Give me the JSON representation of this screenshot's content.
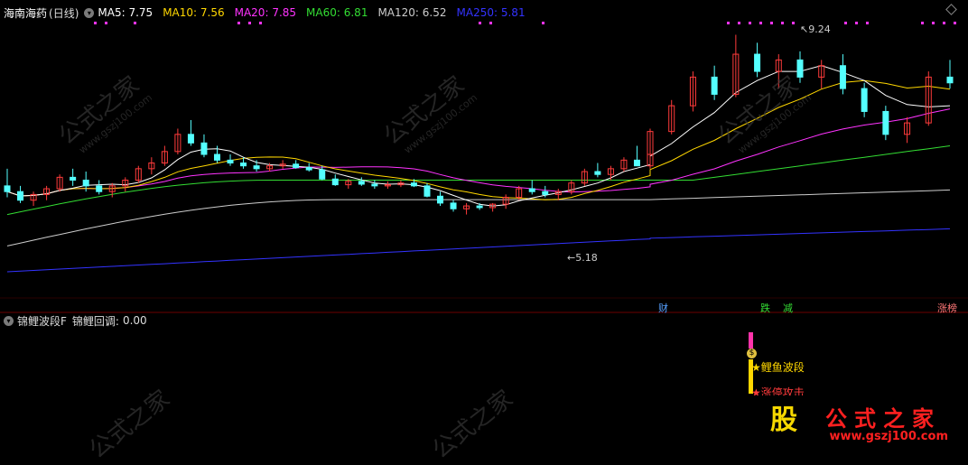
{
  "header": {
    "stock_name": "海南海药",
    "period": "(日线)",
    "ma": [
      {
        "label": "MA5:",
        "value": "7.75",
        "color": "#ffffff"
      },
      {
        "label": "MA10:",
        "value": "7.56",
        "color": "#ffd700"
      },
      {
        "label": "MA20:",
        "value": "7.85",
        "color": "#ff33ff"
      },
      {
        "label": "MA60:",
        "value": "6.81",
        "color": "#33dd33"
      },
      {
        "label": "MA120:",
        "value": "6.52",
        "color": "#cccccc"
      },
      {
        "label": "MA250:",
        "value": "5.81",
        "color": "#3333ff"
      }
    ]
  },
  "annotations": {
    "high_price": "9.24",
    "low_price": "5.18",
    "high_marker": "↖",
    "low_marker": "←",
    "event_cai": "财",
    "event_die": "跌",
    "event_jian": "减",
    "event_zhangban": "涨榜"
  },
  "indicator": {
    "name": "锦鲤波段F",
    "field_label": "锦鲤回调:",
    "field_value": "0.00",
    "signal_label": "★鲤鱼波段",
    "signal_label2": "★涨停攻击",
    "coin_glyph": "$"
  },
  "watermark": {
    "text": "公式之家",
    "url": "www.gszj100.com",
    "logo_glyph": "股"
  },
  "colors": {
    "up": "#ff3b3b",
    "down": "#54ffff",
    "ma5": "#ffffff",
    "ma10": "#ffd700",
    "ma20": "#ff33ff",
    "ma60": "#33dd33",
    "ma120": "#cccccc",
    "ma250": "#3333ff",
    "dots": "#ff33ff",
    "divider": "#6b0000"
  },
  "chart_data": {
    "type": "candlestick",
    "title": "",
    "ylim": [
      4.8,
      9.5
    ],
    "ohlc_approx": [
      [
        6.6,
        6.9,
        6.4,
        6.5
      ],
      [
        6.5,
        6.6,
        6.3,
        6.35
      ],
      [
        6.35,
        6.5,
        6.25,
        6.45
      ],
      [
        6.45,
        6.6,
        6.35,
        6.55
      ],
      [
        6.55,
        6.8,
        6.5,
        6.75
      ],
      [
        6.75,
        6.9,
        6.6,
        6.7
      ],
      [
        6.7,
        6.85,
        6.5,
        6.6
      ],
      [
        6.6,
        6.7,
        6.45,
        6.5
      ],
      [
        6.5,
        6.65,
        6.4,
        6.6
      ],
      [
        6.6,
        6.75,
        6.5,
        6.7
      ],
      [
        6.7,
        6.95,
        6.65,
        6.9
      ],
      [
        6.9,
        7.1,
        6.8,
        7.0
      ],
      [
        7.0,
        7.3,
        6.95,
        7.2
      ],
      [
        7.2,
        7.6,
        7.15,
        7.5
      ],
      [
        7.5,
        7.75,
        7.3,
        7.35
      ],
      [
        7.35,
        7.5,
        7.1,
        7.15
      ],
      [
        7.15,
        7.3,
        7.0,
        7.05
      ],
      [
        7.05,
        7.15,
        6.95,
        7.0
      ],
      [
        7.0,
        7.1,
        6.9,
        6.95
      ],
      [
        6.95,
        7.05,
        6.85,
        6.9
      ],
      [
        6.9,
        7.0,
        6.85,
        6.95
      ],
      [
        6.95,
        7.05,
        6.9,
        6.98
      ],
      [
        6.98,
        7.05,
        6.9,
        6.92
      ],
      [
        6.92,
        7.0,
        6.85,
        6.88
      ],
      [
        6.88,
        6.95,
        6.7,
        6.72
      ],
      [
        6.72,
        6.8,
        6.6,
        6.62
      ],
      [
        6.62,
        6.72,
        6.55,
        6.68
      ],
      [
        6.68,
        6.75,
        6.6,
        6.63
      ],
      [
        6.63,
        6.7,
        6.55,
        6.6
      ],
      [
        6.6,
        6.68,
        6.55,
        6.62
      ],
      [
        6.62,
        6.7,
        6.58,
        6.65
      ],
      [
        6.65,
        6.72,
        6.58,
        6.6
      ],
      [
        6.6,
        6.65,
        6.4,
        6.42
      ],
      [
        6.42,
        6.5,
        6.25,
        6.3
      ],
      [
        6.3,
        6.35,
        6.15,
        6.2
      ],
      [
        6.2,
        6.3,
        6.1,
        6.25
      ],
      [
        6.25,
        6.3,
        6.18,
        6.22
      ],
      [
        6.22,
        6.3,
        6.15,
        6.28
      ],
      [
        6.28,
        6.45,
        6.2,
        6.4
      ],
      [
        6.4,
        6.6,
        6.35,
        6.55
      ],
      [
        6.55,
        6.7,
        6.45,
        6.5
      ],
      [
        6.5,
        6.6,
        6.4,
        6.45
      ],
      [
        6.45,
        6.55,
        6.35,
        6.5
      ],
      [
        6.5,
        6.7,
        6.45,
        6.65
      ],
      [
        6.65,
        6.9,
        6.6,
        6.85
      ],
      [
        6.85,
        7.0,
        6.75,
        6.8
      ],
      [
        6.8,
        6.95,
        6.7,
        6.9
      ],
      [
        6.9,
        7.1,
        6.85,
        7.05
      ],
      [
        7.05,
        7.3,
        6.95,
        6.95
      ],
      [
        6.95,
        7.2,
        6.9,
        7.15
      ],
      [
        7.15,
        7.6,
        7.1,
        7.55
      ],
      [
        7.55,
        8.1,
        7.5,
        8.0
      ],
      [
        8.0,
        8.6,
        7.9,
        8.5
      ],
      [
        8.5,
        8.7,
        8.1,
        8.2
      ],
      [
        8.2,
        9.24,
        8.15,
        8.9
      ],
      [
        8.9,
        9.1,
        8.5,
        8.6
      ],
      [
        8.6,
        8.9,
        8.3,
        8.8
      ],
      [
        8.8,
        8.95,
        8.4,
        8.5
      ],
      [
        8.5,
        8.8,
        8.3,
        8.7
      ],
      [
        8.7,
        8.9,
        8.2,
        8.3
      ],
      [
        8.3,
        8.4,
        7.8,
        7.9
      ],
      [
        7.9,
        8.0,
        7.4,
        7.5
      ],
      [
        7.5,
        7.8,
        7.35,
        7.7
      ],
      [
        7.7,
        8.6,
        7.65,
        8.5
      ],
      [
        8.5,
        8.8,
        8.3,
        8.4
      ]
    ]
  }
}
